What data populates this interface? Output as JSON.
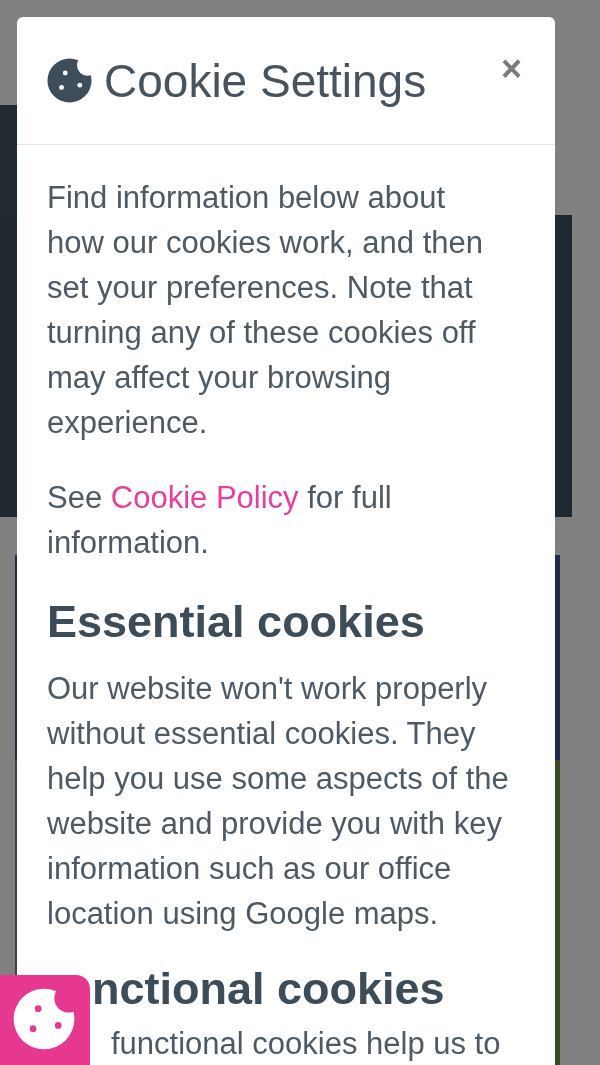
{
  "dialog": {
    "title": "Cookie Settings",
    "close": "×",
    "intro": "Find information below about\nhow our cookies work, and then\nset your preferences. Note that\nturning any of these cookies off\nmay affect your browsing\nexperience.",
    "policy_note": {
      "before": "See",
      "link": "Cookie Policy",
      "after": "for full\ninformation."
    },
    "sections": [
      {
        "heading": "Essential cookies",
        "text": "Our website won't work properly\nwithout essential cookies. They\nhelp you use some aspects of the\nwebsite and provide you with key\ninformation such as our office\nlocation using Google maps."
      },
      {
        "heading": "nctional cookies",
        "text": "functional cookies help us to"
      }
    ]
  }
}
